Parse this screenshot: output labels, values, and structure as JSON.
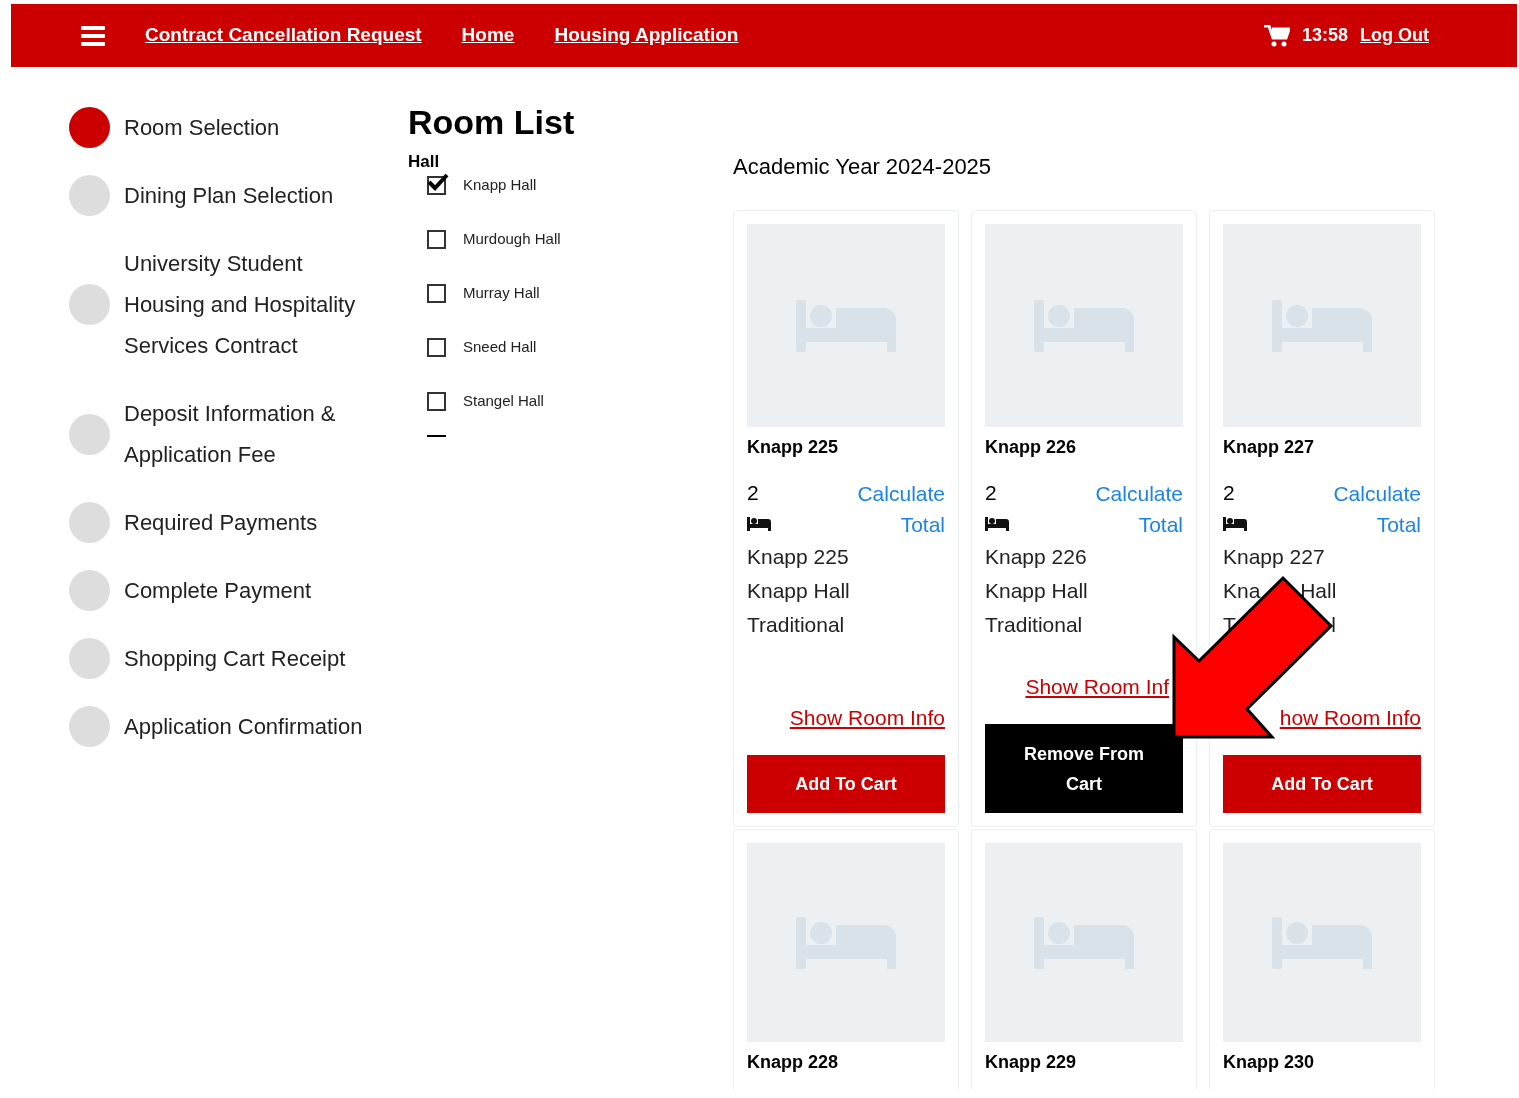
{
  "nav": {
    "links": [
      "Contract Cancellation Request",
      "Home",
      "Housing Application"
    ],
    "time": "13:58",
    "logout": "Log Out"
  },
  "steps": [
    {
      "label": "Room Selection",
      "selected": true
    },
    {
      "label": "Dining Plan Selection",
      "selected": false
    },
    {
      "label": "University Student Housing and Hospitality Services Contract",
      "selected": false
    },
    {
      "label": "Deposit Information & Application Fee",
      "selected": false
    },
    {
      "label": "Required Payments",
      "selected": false
    },
    {
      "label": "Complete Payment",
      "selected": false
    },
    {
      "label": "Shopping Cart Receipt",
      "selected": false
    },
    {
      "label": "Application Confirmation",
      "selected": false
    }
  ],
  "title": "Room List",
  "filter": {
    "heading": "Hall",
    "options": [
      {
        "label": "Knapp Hall",
        "checked": true
      },
      {
        "label": "Murdough Hall",
        "checked": false
      },
      {
        "label": "Murray Hall",
        "checked": false
      },
      {
        "label": "Sneed Hall",
        "checked": false
      },
      {
        "label": "Stangel Hall",
        "checked": false
      }
    ]
  },
  "academic_year": "Academic Year 2024-2025",
  "rooms": [
    {
      "title": "Knapp 225",
      "beds": "2",
      "calc": "Calculate Total",
      "name": "Knapp 225",
      "hall": "Knapp Hall",
      "type": "Traditional",
      "info": "Show Room Info",
      "button": "Add To Cart",
      "in_cart": false
    },
    {
      "title": "Knapp 226",
      "beds": "2",
      "calc": "Calculate Total",
      "name": "Knapp 226",
      "hall": "Knapp Hall",
      "type": "Traditional",
      "info": "Show Room Inf",
      "button": "Remove From Cart",
      "in_cart": true,
      "link_covered": true
    },
    {
      "title": "Knapp 227",
      "beds": "2",
      "calc": "Calculate Total",
      "name": "Knapp 227",
      "hall": "Kna Hall",
      "type": "T l",
      "info": "how Room Info",
      "button": "Add To Cart",
      "in_cart": false,
      "text_covered": true
    },
    {
      "title": "Knapp 228"
    },
    {
      "title": "Knapp 229"
    },
    {
      "title": "Knapp 230"
    }
  ]
}
